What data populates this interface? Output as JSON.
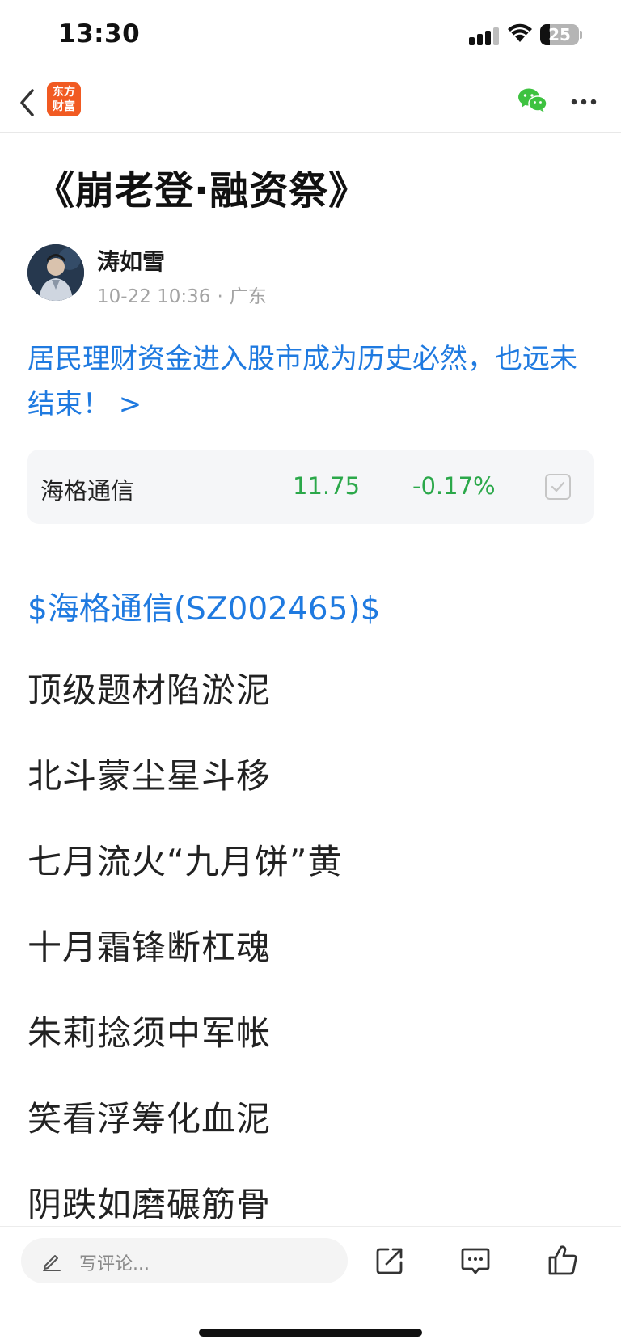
{
  "status_bar": {
    "time": "13:30",
    "battery_level": "25",
    "battery_fraction": 0.25
  },
  "nav": {
    "logo_line1": "东方",
    "logo_line2": "财富",
    "brand_color": "#f15a22"
  },
  "article": {
    "title": "《崩老登·融资祭》",
    "author": "涛如雪",
    "date": "10-22 10:36",
    "separator": "·",
    "location": "广东",
    "headline_link": "居民理财资金进入股市成为历史必然，也远未结束！ >"
  },
  "stock_card": {
    "name": "海格通信",
    "price": "11.75",
    "change": "-0.17%",
    "change_color": "#2ba84a"
  },
  "body": {
    "stock_tag": "$海格通信(SZ002465)$",
    "lines": [
      "顶级题材陷淤泥",
      "北斗蒙尘星斗移",
      "七月流火“九月饼”黄",
      "十月霜锋断杠魂",
      "朱莉捻须中军帐",
      "笑看浮筹化血泥",
      "阴跌如磨碾筋骨"
    ]
  },
  "bottom_bar": {
    "comment_placeholder": "写评论..."
  },
  "colors": {
    "link_blue": "#1f7ae0",
    "text": "#222222",
    "meta_gray": "#a3a3a3"
  }
}
